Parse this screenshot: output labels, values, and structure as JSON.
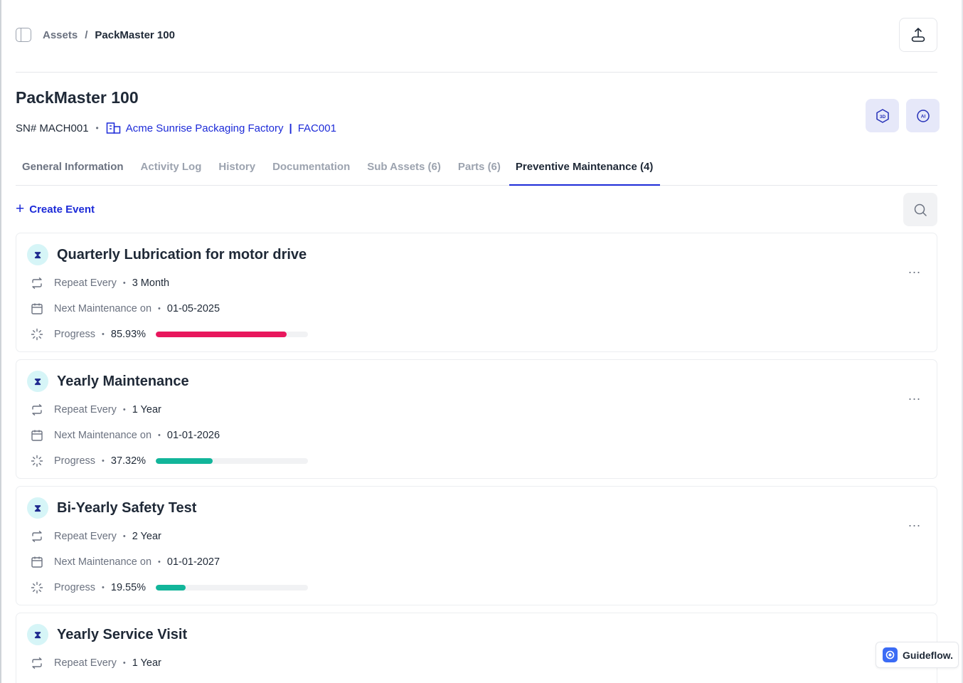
{
  "breadcrumb": {
    "root": "Assets",
    "separator": "/",
    "current": "PackMaster 100"
  },
  "asset": {
    "title": "PackMaster 100",
    "serial": "SN# MACH001",
    "factory_name": "Acme Sunrise Packaging Factory",
    "factory_sep": "|",
    "factory_code": "FAC001"
  },
  "view_buttons": {
    "three_d": "3D",
    "ai": "AI"
  },
  "tabs": [
    {
      "label": "General Information"
    },
    {
      "label": "Activity Log"
    },
    {
      "label": "History"
    },
    {
      "label": "Documentation"
    },
    {
      "label": "Sub Assets (6)"
    },
    {
      "label": "Parts (6)"
    },
    {
      "label": "Preventive Maintenance (4)"
    }
  ],
  "active_tab": "Preventive Maintenance (4)",
  "create_event": "Create Event",
  "labels": {
    "repeat": "Repeat Every",
    "next": "Next Maintenance on",
    "progress": "Progress",
    "bullet": "•",
    "menu": "..."
  },
  "events": [
    {
      "title": "Quarterly Lubrication for motor drive",
      "repeat": "3 Month",
      "next": "01-05-2025",
      "progress_text": "85.93%",
      "progress": 85.93,
      "color": "#e8175d"
    },
    {
      "title": "Yearly Maintenance",
      "repeat": "1 Year",
      "next": "01-01-2026",
      "progress_text": "37.32%",
      "progress": 37.32,
      "color": "#12b59a"
    },
    {
      "title": "Bi-Yearly Safety Test",
      "repeat": "2 Year",
      "next": "01-01-2027",
      "progress_text": "19.55%",
      "progress": 19.55,
      "color": "#12b59a"
    },
    {
      "title": "Yearly Service Visit",
      "repeat": "1 Year"
    }
  ],
  "guideflow": "Guideflow."
}
